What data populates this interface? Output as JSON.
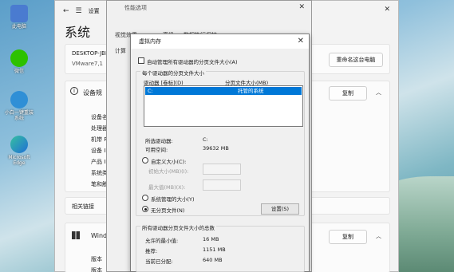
{
  "desktop": {
    "icons": [
      {
        "label": "此电脑",
        "color": "#4a7bd0"
      },
      {
        "label": "微信",
        "color": "#2dc100"
      },
      {
        "label": "小白一键重装系统",
        "color": "#2f8fd6"
      },
      {
        "label": "Microsoft Edge",
        "color": "#1f8ad6"
      }
    ]
  },
  "settings": {
    "title": "设置",
    "heading": "系统",
    "device": {
      "name": "DESKTOP-JBIR",
      "model": "VMware7,1"
    },
    "rename_button": "重命名这台电脑",
    "device_specs_title": "设备规",
    "copy_button": "复制",
    "spec_labels": [
      "设备名",
      "处理器",
      "机带 R",
      "设备 ID",
      "产品 ID",
      "系统类",
      "笔和触"
    ],
    "related_links": "相关链接",
    "windows_title": "Windo",
    "win_labels": [
      "版本",
      "版本"
    ]
  },
  "perf": {
    "title": "性能选项",
    "tabs": [
      "视觉效果",
      "高级",
      "数据执行保护"
    ],
    "tab_label": "计算"
  },
  "vm": {
    "title": "虚拟内存",
    "auto_manage_label": "自动管理所有驱动器的分页文件大小(A)",
    "per_drive_title": "每个驱动器的分页文件大小",
    "col_drive": "驱动器 [卷标](D)",
    "col_size": "分页文件大小(MB)",
    "drive_row": {
      "drive": "C:",
      "size": "托管的系统"
    },
    "selected_drive_label": "所选驱动器:",
    "selected_drive_value": "C:",
    "free_space_label": "可用空间:",
    "free_space_value": "39632 MB",
    "custom_size_label": "自定义大小(C):",
    "initial_size_label": "初始大小(MB)(I):",
    "max_size_label": "最大值(MB)(X):",
    "system_managed_label": "系统管理的大小(Y)",
    "no_paging_label": "无分页文件(N)",
    "set_button": "设置(S)",
    "total_title": "所有驱动器分页文件大小的总数",
    "min_allowed_label": "允许的最小值:",
    "min_allowed_value": "16 MB",
    "recommended_label": "推荐:",
    "recommended_value": "1151 MB",
    "current_label": "当前已分配:",
    "current_value": "640 MB"
  }
}
